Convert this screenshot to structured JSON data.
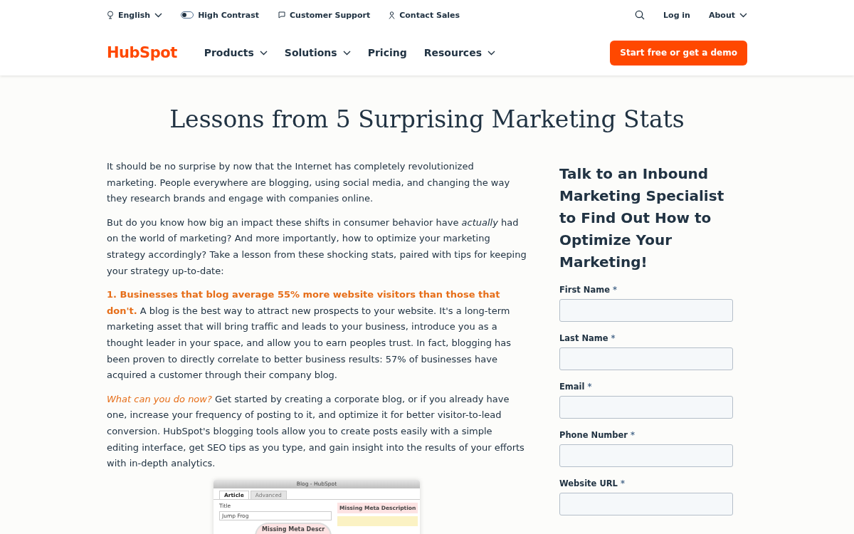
{
  "utility_bar": {
    "language": "English",
    "contrast": {
      "label": "High Contrast",
      "on": false
    },
    "support": "Customer Support",
    "sales": "Contact Sales",
    "login": "Log in",
    "about": "About"
  },
  "nav": {
    "logo": "HubSpot",
    "items": [
      {
        "label": "Products",
        "dropdown": true
      },
      {
        "label": "Solutions",
        "dropdown": true
      },
      {
        "label": "Pricing",
        "dropdown": false
      },
      {
        "label": "Resources",
        "dropdown": true
      }
    ],
    "cta": "Start free or get a demo"
  },
  "article": {
    "title": "Lessons from 5 Surprising Marketing Stats",
    "paragraphs": [
      {
        "kind": "plain",
        "text": "It should be no surprise by now that the Internet has completely revolutionized marketing. People everywhere are blogging, using social media, and changing the way they research brands and engage with companies online."
      },
      {
        "kind": "plain",
        "text": "But do you know how big an impact these shifts in consumer behavior have *actually* had on the world of marketing? And more importantly, how to optimize your marketing strategy accordingly? Take a lesson from these shocking stats, paired with tips for keeping your strategy up-to-date:"
      },
      {
        "kind": "stat",
        "lead": "1. Businesses that blog average 55% more website visitors than those that don't.",
        "text": "A blog is the best way to attract new prospects to your website. It's a long-term marketing asset that will bring traffic and leads to your business, introduce you as a thought leader in your space, and allow you to earn peoples trust. In fact, blogging has been proven to directly correlate to better business results: 57% of businesses have acquired a customer through their company blog."
      },
      {
        "kind": "tip",
        "lead": "What can you do now?",
        "text": "Get started by creating a corporate blog, or if you already have one, increase your frequency of posting to it, and optimize it for better visitor-to-lead conversion. HubSpot's blogging tools allow you to create posts easily with a simple editing interface, get SEO tips as you type, and gain insight into the results of your efforts with in-depth analytics."
      }
    ],
    "screenshot": {
      "window_title": "Blog - HubSpot",
      "tabs": [
        {
          "label": "Article",
          "selected": true
        },
        {
          "label": "Advanced",
          "selected": false
        }
      ],
      "title_label": "Title",
      "title_value": "Jump Frog",
      "warning": "Missing Meta Description",
      "magnified": "Missing Meta Descr"
    }
  },
  "form": {
    "heading": "Talk to an Inbound Marketing Specialist to Find Out How to Optimize Your Marketing!",
    "fields": [
      {
        "label": "First Name",
        "required_mark": "*"
      },
      {
        "label": "Last Name",
        "required_mark": "*"
      },
      {
        "label": "Email",
        "required_mark": "*"
      },
      {
        "label": "Phone Number",
        "required_mark": "*"
      },
      {
        "label": "Website URL",
        "required_mark": "*"
      }
    ]
  }
}
